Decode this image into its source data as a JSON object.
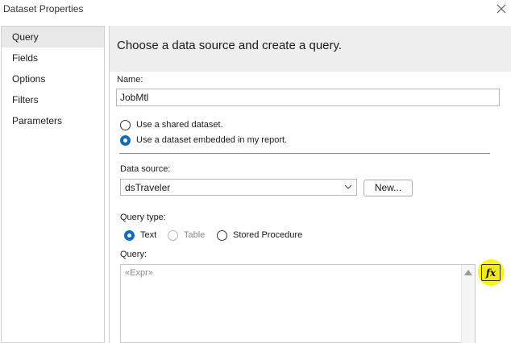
{
  "window": {
    "title": "Dataset Properties"
  },
  "sidebar": {
    "items": [
      {
        "label": "Query",
        "active": true
      },
      {
        "label": "Fields",
        "active": false
      },
      {
        "label": "Options",
        "active": false
      },
      {
        "label": "Filters",
        "active": false
      },
      {
        "label": "Parameters",
        "active": false
      }
    ]
  },
  "main": {
    "header": "Choose a data source and create a query.",
    "name_label": "Name:",
    "name_value": "JobMtl",
    "dataset_options": [
      {
        "label": "Use a shared dataset.",
        "checked": false
      },
      {
        "label": "Use a dataset embedded in my report.",
        "checked": true
      }
    ],
    "data_source_label": "Data source:",
    "data_source_value": "dsTraveler",
    "new_button": "New...",
    "query_type_label": "Query type:",
    "query_types": [
      {
        "label": "Text",
        "checked": true,
        "disabled": false
      },
      {
        "label": "Table",
        "checked": false,
        "disabled": true
      },
      {
        "label": "Stored Procedure",
        "checked": false,
        "disabled": false
      }
    ],
    "query_label": "Query:",
    "query_value": "«Expr»",
    "expression_button": "fx"
  },
  "colors": {
    "accent": "#0f6cbd",
    "highlight": "#fbf31c",
    "header_bg": "#eeeeee"
  }
}
